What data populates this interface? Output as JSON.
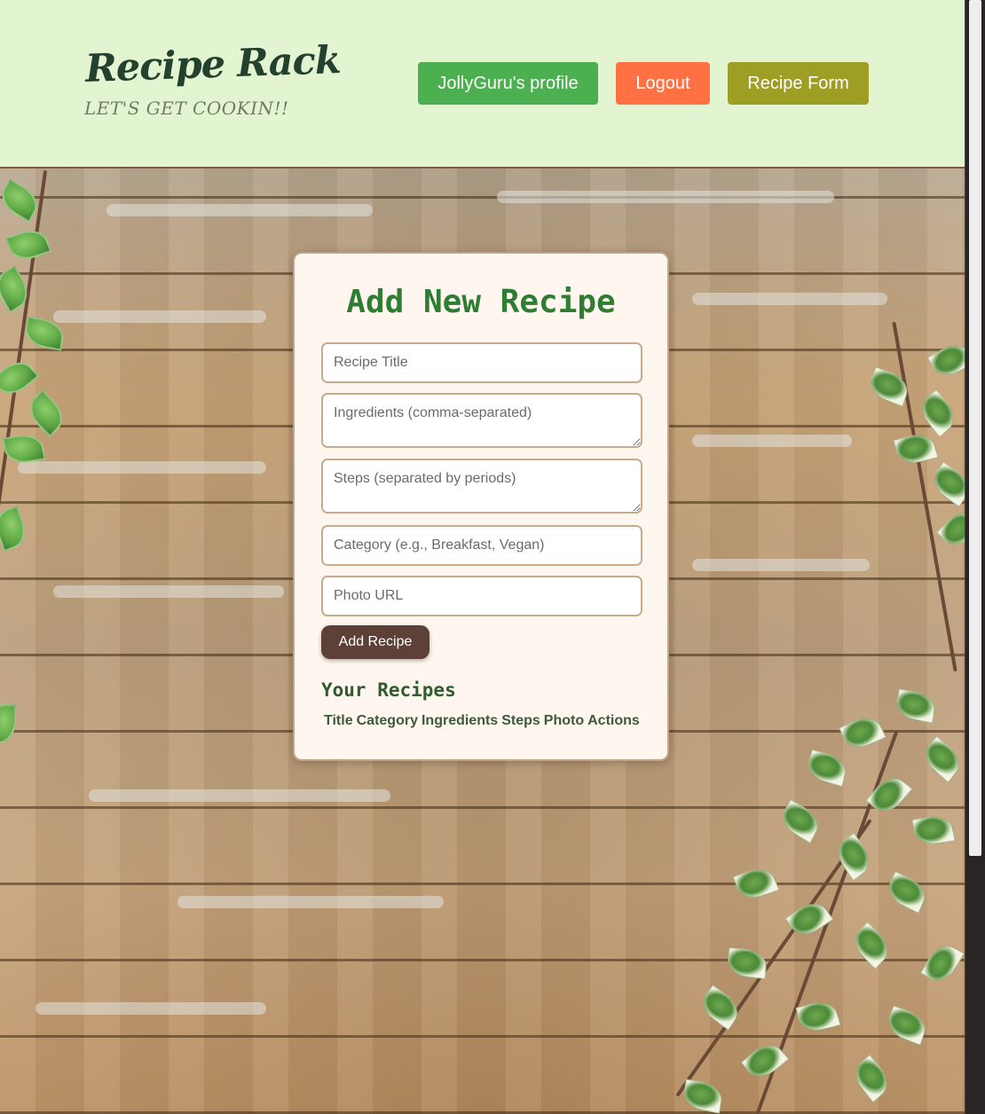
{
  "header": {
    "brand_title": "Recipe Rack",
    "brand_tagline": "LET'S GET COOKIN!!",
    "profile_button": "JollyGuru's profile",
    "logout_button": "Logout",
    "recipe_form_button": "Recipe Form"
  },
  "form": {
    "title": "Add New Recipe",
    "recipe_title_placeholder": "Recipe Title",
    "ingredients_placeholder": "Ingredients (comma-separated)",
    "steps_placeholder": "Steps (separated by periods)",
    "category_placeholder": "Category (e.g., Breakfast, Vegan)",
    "photo_url_placeholder": "Photo URL",
    "submit_label": "Add Recipe"
  },
  "recipes": {
    "heading": "Your Recipes",
    "columns": [
      "Title",
      "Category",
      "Ingredients",
      "Steps",
      "Photo",
      "Actions"
    ]
  },
  "colors": {
    "header_bg": "#e3f5d0",
    "profile_button": "#4caf50",
    "logout_button": "#ff7043",
    "recipe_form_button": "#9e9d24",
    "form_title": "#2e7d32",
    "submit_button": "#5d4037",
    "card_bg": "#fff6ef"
  }
}
